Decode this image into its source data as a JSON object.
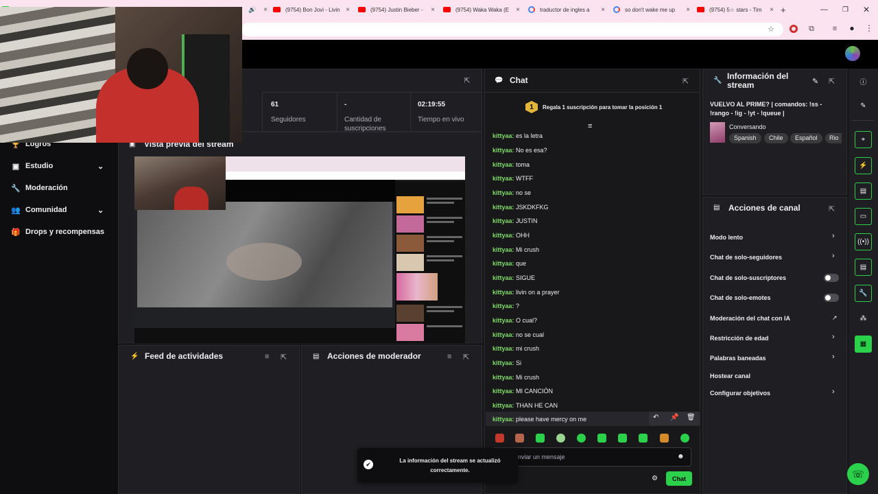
{
  "browser": {
    "tabs": [
      {
        "label": "(9754) Bon Jovi - Livin",
        "type": "youtube"
      },
      {
        "label": "(9754) Justin Bieber -",
        "type": "youtube"
      },
      {
        "label": "(9754) Waka Waka (E",
        "type": "youtube"
      },
      {
        "label": "traductor de ingles a",
        "type": "google"
      },
      {
        "label": "so don't wake me up",
        "type": "google"
      },
      {
        "label": "(9754) 5☆ stars - Tim",
        "type": "youtube"
      }
    ],
    "new_tab": "+"
  },
  "sidebar": {
    "items": [
      {
        "label": "Logros",
        "icon": "trophy-icon"
      },
      {
        "label": "Estudio",
        "icon": "studio-icon",
        "chevron": true
      },
      {
        "label": "Moderación",
        "icon": "wrench-icon"
      },
      {
        "label": "Comunidad",
        "icon": "people-icon",
        "chevron": true
      },
      {
        "label": "Drops y recompensas",
        "icon": "gift-icon"
      }
    ]
  },
  "stats": [
    {
      "value": "61",
      "label": "Seguidores"
    },
    {
      "value": "-",
      "label": "Cantidad de suscripciones"
    },
    {
      "value": "02:19:55",
      "label": "Tiempo en vivo"
    }
  ],
  "panels": {
    "preview_title": "Vista previa del stream",
    "activity_title": "Feed de actividades",
    "mod_actions_title": "Acciones de moderador",
    "chat_title": "Chat",
    "info_title": "Información del stream",
    "channel_actions_title": "Acciones de canal"
  },
  "chat": {
    "gift_rank": "1",
    "gift_text": "Regala 1 suscripción para tomar la posición 1",
    "messages": [
      {
        "user": "kittyaa",
        "text": "es la letra"
      },
      {
        "user": "kittyaa",
        "text": "No es esa?"
      },
      {
        "user": "kittyaa",
        "text": "toma"
      },
      {
        "user": "kittyaa",
        "text": "WTFF"
      },
      {
        "user": "kittyaa",
        "text": "no se"
      },
      {
        "user": "kittyaa",
        "text": "JSKDKFKG"
      },
      {
        "user": "kittyaa",
        "text": "JUSTIN"
      },
      {
        "user": "kittyaa",
        "text": "OHH"
      },
      {
        "user": "kittyaa",
        "text": "Mi crush"
      },
      {
        "user": "kittyaa",
        "text": "que"
      },
      {
        "user": "kittyaa",
        "text": "SIGUE"
      },
      {
        "user": "kittyaa",
        "text": "livin on a prayer"
      },
      {
        "user": "kittyaa",
        "text": "?"
      },
      {
        "user": "kittyaa",
        "text": "O cual?"
      },
      {
        "user": "kittyaa",
        "text": "no se cual"
      },
      {
        "user": "kittyaa",
        "text": "mi crush"
      },
      {
        "user": "kittyaa",
        "text": "Si"
      },
      {
        "user": "kittyaa",
        "text": "Mi crush"
      },
      {
        "user": "kittyaa",
        "text": "MI CANCIÓN"
      },
      {
        "user": "kittyaa",
        "text": "THAN HE CAN"
      },
      {
        "user": "kittyaa",
        "text": "please have mercy on me"
      }
    ],
    "input_placeholder": "Enviar un mensaje",
    "send_label": "Chat"
  },
  "toast": {
    "text": "La información del stream se actualizó correctamente."
  },
  "stream_info": {
    "title": "VUELVO AL PRIME? | comandos: !ss - !rango - !ig - !yt - !queue |",
    "category": "Conversando",
    "tags": [
      "Spanish",
      "Chile",
      "Español",
      "Rio"
    ]
  },
  "channel_actions": [
    {
      "label": "Modo lento",
      "control": "chevron"
    },
    {
      "label": "Chat de solo-seguidores",
      "control": "chevron"
    },
    {
      "label": "Chat de solo-suscriptores",
      "control": "toggle"
    },
    {
      "label": "Chat de solo-emotes",
      "control": "toggle"
    },
    {
      "label": "Moderación del chat con IA",
      "control": "external"
    },
    {
      "label": "Restricción de edad",
      "control": "chevron"
    },
    {
      "label": "Palabras baneadas",
      "control": "chevron"
    },
    {
      "label": "Hostear canal",
      "control": "none"
    },
    {
      "label": "Configurar objetivos",
      "control": "chevron"
    }
  ],
  "colors": {
    "accent_green": "#2bd14b",
    "username_green": "#7cdc61",
    "badge_gold": "#e2b53a"
  }
}
